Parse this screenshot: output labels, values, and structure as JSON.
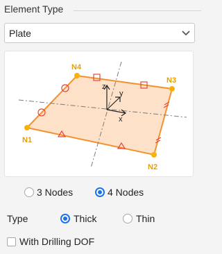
{
  "element_type": {
    "group_title": "Element Type",
    "select_value": "Plate",
    "diagram": {
      "nodes": [
        "N1",
        "N2",
        "N3",
        "N4"
      ],
      "axes": [
        "z",
        "y",
        "x"
      ],
      "colors": {
        "plate_fill": "#fde1c8",
        "plate_edge": "#f2912e",
        "node": "#f9b10a",
        "node_label": "#e8a000",
        "constraint": "#e8443a",
        "axis_line": "#7a7a7a"
      }
    },
    "node_count": {
      "options": [
        "3 Nodes",
        "4 Nodes"
      ],
      "selected": "4 Nodes"
    },
    "type": {
      "label": "Type",
      "options": [
        "Thick",
        "Thin"
      ],
      "selected": "Thick"
    },
    "drilling_dof": {
      "label": "With Drilling DOF",
      "checked": false
    }
  }
}
